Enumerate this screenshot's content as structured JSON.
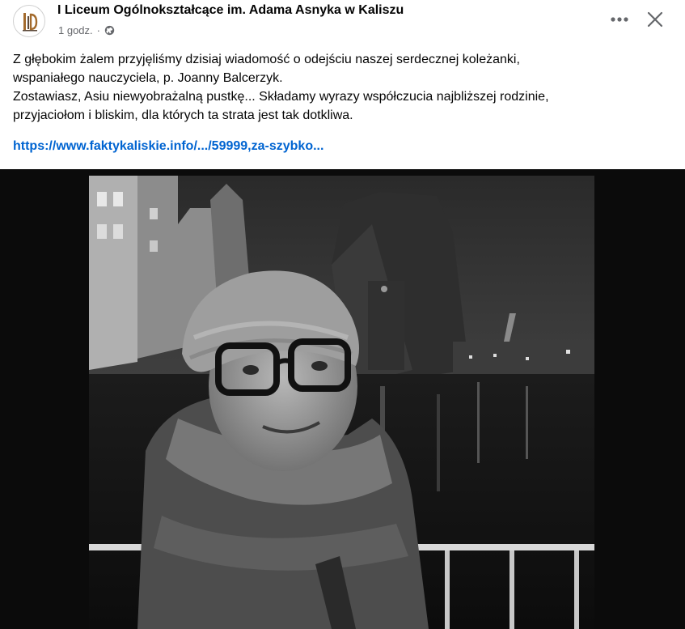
{
  "post": {
    "author": "I Liceum Ogólnokształcące im. Adama Asnyka w Kaliszu",
    "time": "1 godz.",
    "separator": "·",
    "audience_icon": "globe-icon",
    "menu_icon": "more-dots-icon",
    "close_icon": "close-icon",
    "text_lines": [
      "Z głębokim żalem przyjęliśmy dzisiaj wiadomość o odejściu naszej serdecznej koleżanki,",
      "wspaniałego nauczyciela, p. Joanny Balcerzyk.",
      "Zostawiasz, Asiu niewyobrażalną pustkę... Składamy wyrazy współczucia najbliższej rodzinie,",
      "przyjaciołom i bliskim, dla których ta strata jest tak dotkliwa."
    ],
    "link": "https://www.faktykaliskie.info/.../59999,za-szybko..."
  },
  "colors": {
    "text": "#050505",
    "secondary": "#65676b",
    "link": "#0064d1",
    "media_background": "#0b0b0b"
  }
}
